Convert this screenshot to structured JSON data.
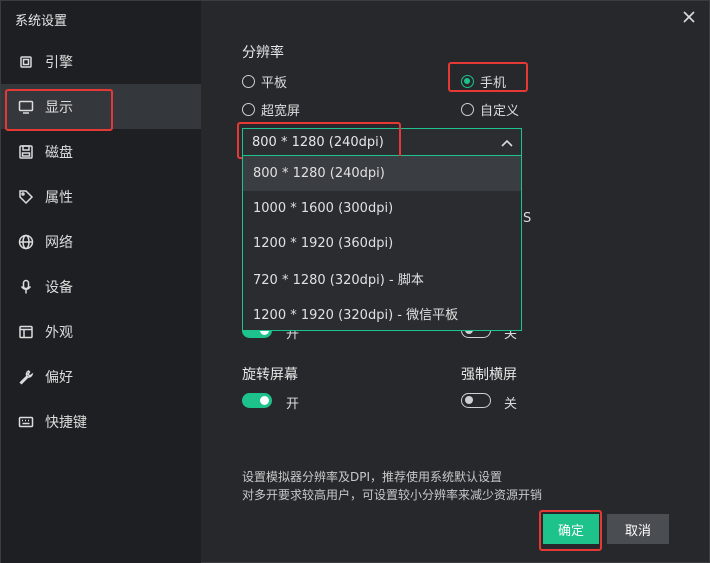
{
  "window": {
    "title": "系统设置"
  },
  "sidebar": {
    "items": [
      {
        "label": "引擎",
        "icon": "engine-icon",
        "active": false
      },
      {
        "label": "显示",
        "icon": "monitor-icon",
        "active": true
      },
      {
        "label": "磁盘",
        "icon": "disk-icon",
        "active": false
      },
      {
        "label": "属性",
        "icon": "tag-icon",
        "active": false
      },
      {
        "label": "网络",
        "icon": "globe-icon",
        "active": false
      },
      {
        "label": "设备",
        "icon": "microphone-icon",
        "active": false
      },
      {
        "label": "外观",
        "icon": "appearance-icon",
        "active": false
      },
      {
        "label": "偏好",
        "icon": "wrench-icon",
        "active": false
      },
      {
        "label": "快捷键",
        "icon": "keyboard-icon",
        "active": false
      }
    ]
  },
  "resolution": {
    "title": "分辨率",
    "options": {
      "tablet": "平板",
      "phone": "手机",
      "ultrawide": "超宽屏",
      "custom": "自定义"
    },
    "selected_option": "phone",
    "select_value": "800 * 1280 (240dpi)",
    "dropdown": [
      "800 * 1280 (240dpi)",
      "1000 * 1600 (300dpi)",
      "1200 * 1920 (360dpi)",
      "720 * 1280 (320dpi) - 脚本",
      "1200 * 1920 (320dpi) - 微信平板"
    ],
    "partial_right_label": "S"
  },
  "toggles_partial": {
    "left_label": "开",
    "right_label": "关"
  },
  "rotate": {
    "title": "旋转屏幕",
    "state_label": "开",
    "on": true
  },
  "force_landscape": {
    "title": "强制横屏",
    "state_label": "关",
    "on": false
  },
  "notes": [
    "设置模拟器分辨率及DPI，推荐使用系统默认设置",
    "对多开要求较高用户，可设置较小分辨率来减少资源开销"
  ],
  "buttons": {
    "confirm": "确定",
    "cancel": "取消"
  },
  "colors": {
    "accent": "#1ec28b",
    "highlight": "#e53935",
    "sidebar_bg": "#1d1f22",
    "content_bg": "#26282b"
  }
}
